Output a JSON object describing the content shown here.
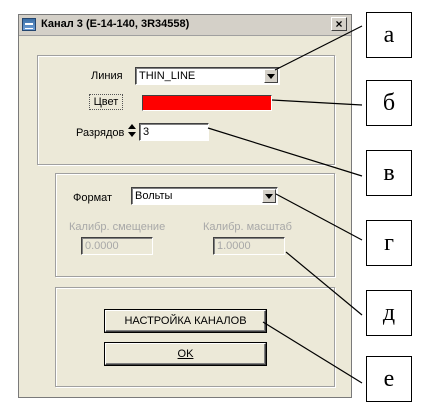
{
  "window": {
    "title": "Канал 3 (E-14-140, 3R34558)",
    "close_label": "×"
  },
  "line_group": {
    "line_label": "Линия",
    "line_value": "THIN_LINE",
    "color_label": "Цвет",
    "color_value": "#ff0000",
    "digits_label": "Разрядов",
    "digits_value": "3"
  },
  "format_group": {
    "format_label": "Формат",
    "format_value": "Вольты",
    "offset_label": "Калибр. смещение",
    "offset_value": "0.0000",
    "scale_label": "Калибр. масштаб",
    "scale_value": "1.0000"
  },
  "buttons": {
    "channels_label": "НАСТРОЙКА КАНАЛОВ",
    "ok_label": "OK"
  },
  "callouts": [
    "а",
    "б",
    "в",
    "г",
    "д",
    "е"
  ]
}
